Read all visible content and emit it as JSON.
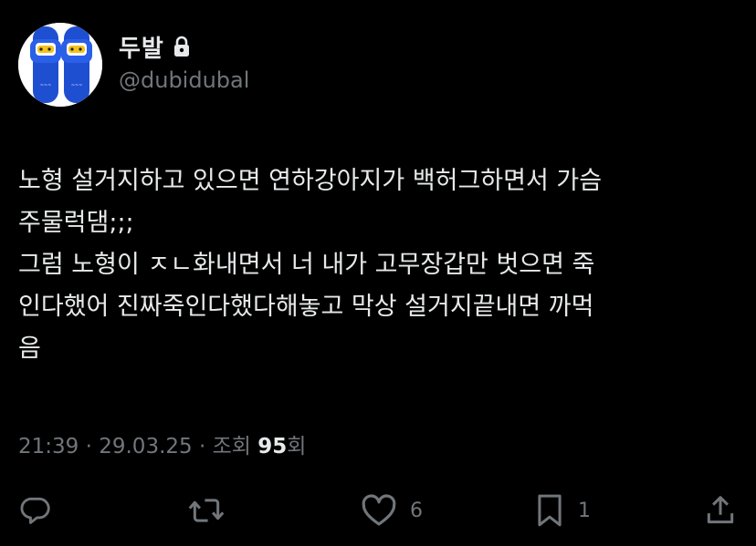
{
  "author": {
    "display_name": "두발",
    "handle": "@dubidubal",
    "protected": true,
    "avatar": "blue-slippers-avatar"
  },
  "tweet": {
    "lines": [
      "노형 설거지하고 있으면 연하강아지가 백허그하면서 가슴",
      "주물럭댐;;;",
      "그럼 노형이 ㅈㄴ화내면서 너 내가 고무장갑만 벗으면 죽",
      "인다했어 진짜죽인다했다해놓고 막상 설거지끝내면 까먹",
      "음"
    ]
  },
  "meta": {
    "time": "21:39",
    "separator": " · ",
    "date": "29.03.25",
    "views_label": "조회",
    "views_count": "95",
    "views_suffix": "회"
  },
  "actions": {
    "reply_icon": "reply-icon",
    "retweet_icon": "retweet-icon",
    "like_icon": "heart-icon",
    "like_count": "6",
    "bookmark_icon": "bookmark-icon",
    "bookmark_count": "1",
    "share_icon": "share-icon"
  },
  "colors": {
    "background": "#000000",
    "text_primary": "#e7e9ea",
    "text_secondary": "#71767b",
    "avatar_blue": "#1f4fd1"
  }
}
